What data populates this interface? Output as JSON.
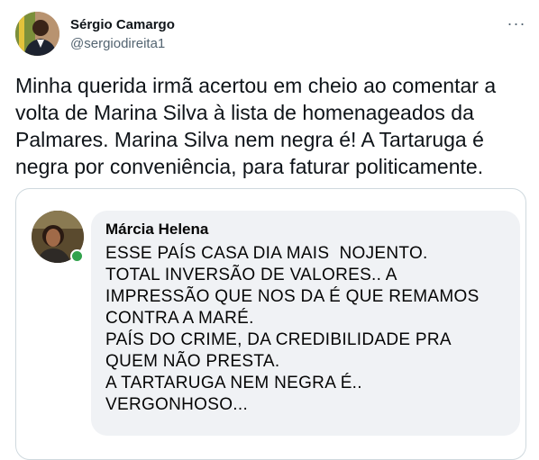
{
  "tweet": {
    "author_name": "Sérgio Camargo",
    "author_handle": "@sergiodireita1",
    "more_icon": "more-horizontal-icon",
    "text": "Minha querida irmã acertou em cheio ao comentar a volta de Marina Silva à lista de homenageados da Palmares. Marina Silva nem negra é! A Tartaruga é negra por conveniência, para faturar politicamente."
  },
  "embedded_post": {
    "author_name": "Márcia Helena",
    "online_status_color": "#31a24c",
    "lines": [
      "ESSE PAÍS CASA DIA MAIS  NOJENTO.",
      "TOTAL INVERSÃO DE VALORES.. A",
      "IMPRESSÃO QUE NOS DA É QUE REMAMOS",
      "CONTRA A MARÉ.",
      "PAÍS DO CRIME, DA CREDIBILIDADE PRA",
      "QUEM NÃO PRESTA.",
      "A TARTARUGA NEM NEGRA É..",
      "VERGONHOSO..."
    ]
  }
}
